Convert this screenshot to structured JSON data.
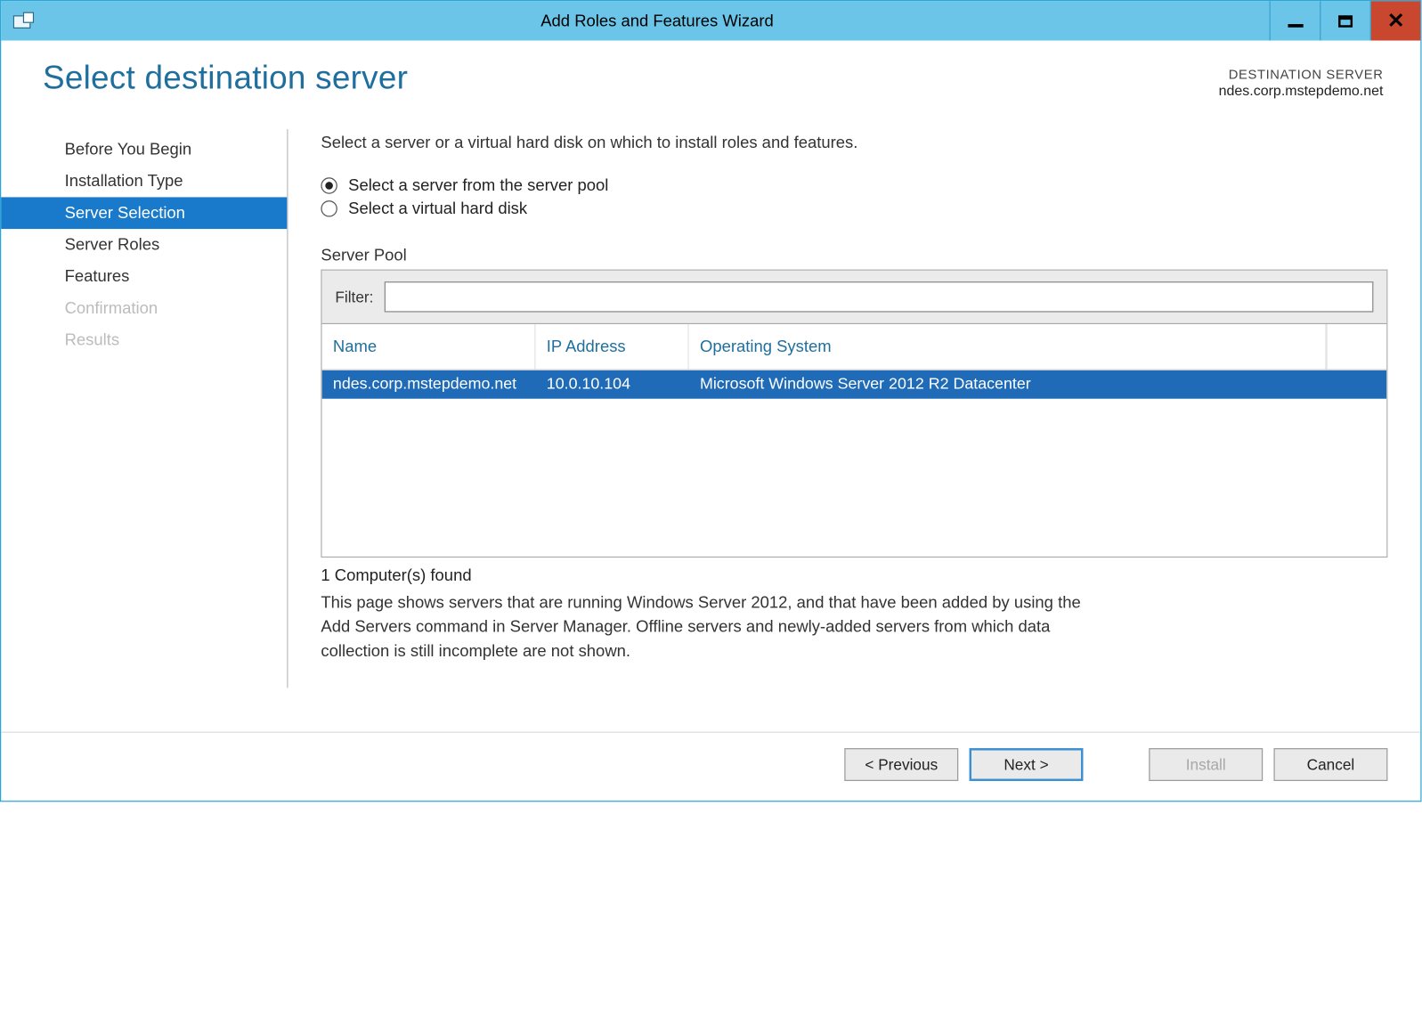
{
  "window": {
    "title": "Add Roles and Features Wizard"
  },
  "header": {
    "page_title": "Select destination server",
    "dest_label": "DESTINATION SERVER",
    "dest_host": "ndes.corp.mstepdemo.net"
  },
  "sidebar": {
    "items": [
      {
        "label": "Before You Begin",
        "state": "normal"
      },
      {
        "label": "Installation Type",
        "state": "normal"
      },
      {
        "label": "Server Selection",
        "state": "selected"
      },
      {
        "label": "Server Roles",
        "state": "normal"
      },
      {
        "label": "Features",
        "state": "normal"
      },
      {
        "label": "Confirmation",
        "state": "disabled"
      },
      {
        "label": "Results",
        "state": "disabled"
      }
    ]
  },
  "main": {
    "instruction": "Select a server or a virtual hard disk on which to install roles and features.",
    "radios": [
      {
        "label": "Select a server from the server pool",
        "checked": true
      },
      {
        "label": "Select a virtual hard disk",
        "checked": false
      }
    ],
    "pool_label": "Server Pool",
    "filter_label": "Filter:",
    "filter_value": "",
    "columns": {
      "name": "Name",
      "ip": "IP Address",
      "os": "Operating System"
    },
    "rows": [
      {
        "name": "ndes.corp.mstepdemo.net",
        "ip": "10.0.10.104",
        "os": "Microsoft Windows Server 2012 R2 Datacenter",
        "selected": true
      }
    ],
    "found_line": "1 Computer(s) found",
    "hint": "This page shows servers that are running Windows Server 2012, and that have been added by using the Add Servers command in Server Manager. Offline servers and newly-added servers from which data collection is still incomplete are not shown."
  },
  "footer": {
    "previous": "< Previous",
    "next": "Next >",
    "install": "Install",
    "cancel": "Cancel"
  }
}
